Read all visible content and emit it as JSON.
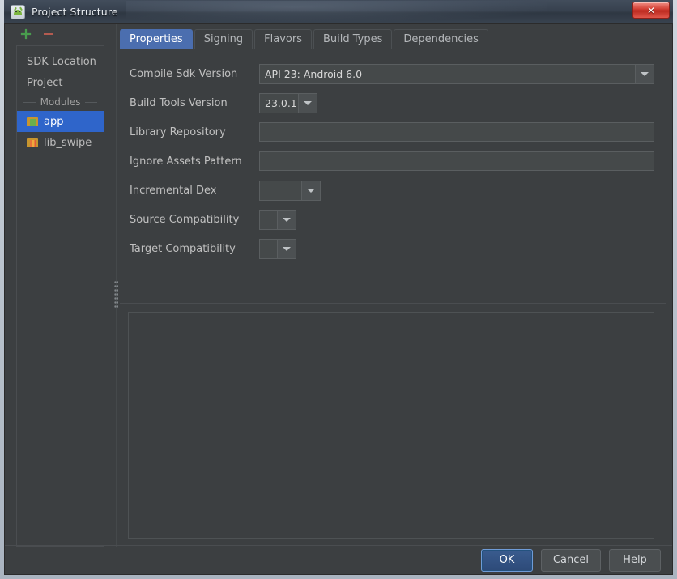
{
  "window": {
    "title": "Project Structure",
    "app_icon": "android-studio-icon",
    "close_label": "✕"
  },
  "sidebar": {
    "toolbar": {
      "add_label": "+",
      "remove_label": "−"
    },
    "items": [
      {
        "label": "SDK Location",
        "selected": false,
        "icon": ""
      },
      {
        "label": "Project",
        "selected": false,
        "icon": ""
      }
    ],
    "group_label": "Modules",
    "modules": [
      {
        "label": "app",
        "selected": true,
        "icon": "android-module-icon"
      },
      {
        "label": "lib_swipe",
        "selected": false,
        "icon": "library-module-icon"
      }
    ]
  },
  "tabs": [
    {
      "label": "Properties",
      "active": true
    },
    {
      "label": "Signing",
      "active": false
    },
    {
      "label": "Flavors",
      "active": false
    },
    {
      "label": "Build Types",
      "active": false
    },
    {
      "label": "Dependencies",
      "active": false
    }
  ],
  "form": {
    "compile_sdk_version": {
      "label": "Compile Sdk Version",
      "value": "API 23: Android 6.0"
    },
    "build_tools_version": {
      "label": "Build Tools Version",
      "value": "23.0.1"
    },
    "library_repository": {
      "label": "Library Repository",
      "value": "",
      "placeholder": ""
    },
    "ignore_assets_pattern": {
      "label": "Ignore Assets Pattern",
      "value": "",
      "placeholder": ""
    },
    "incremental_dex": {
      "label": "Incremental Dex",
      "value": ""
    },
    "source_compatibility": {
      "label": "Source Compatibility",
      "value": ""
    },
    "target_compatibility": {
      "label": "Target Compatibility",
      "value": ""
    }
  },
  "footer": {
    "ok_label": "OK",
    "cancel_label": "Cancel",
    "help_label": "Help"
  },
  "colors": {
    "accent": "#4b6eaf",
    "selection": "#2f65ca",
    "background": "#3c3f41",
    "close_button": "#d6453a"
  }
}
